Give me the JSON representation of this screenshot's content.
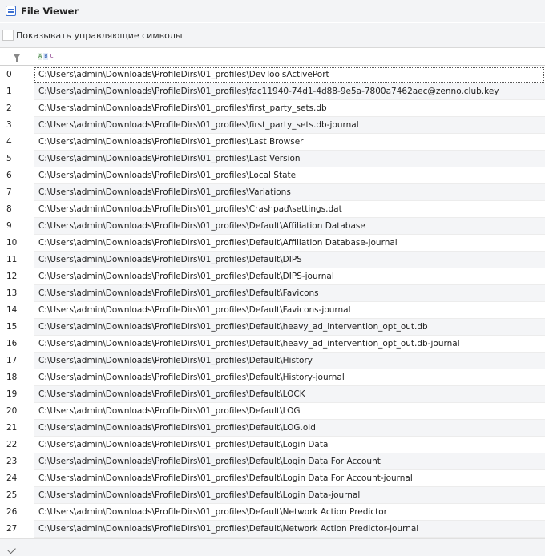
{
  "window": {
    "title": "File Viewer",
    "title_icon": "list-icon"
  },
  "options": {
    "show_control_chars_label": "Показывать управляющие символы",
    "show_control_chars_checked": false
  },
  "grid": {
    "filter_icon": "filter-icon",
    "column_type_icon": "abc-icon",
    "rows": [
      {
        "index": "0",
        "value": "C:\\Users\\admin\\Downloads\\ProfileDirs\\01_profiles\\DevToolsActivePort"
      },
      {
        "index": "1",
        "value": "C:\\Users\\admin\\Downloads\\ProfileDirs\\01_profiles\\fac11940-74d1-4d88-9e5a-7800a7462aec@zenno.club.key"
      },
      {
        "index": "2",
        "value": "C:\\Users\\admin\\Downloads\\ProfileDirs\\01_profiles\\first_party_sets.db"
      },
      {
        "index": "3",
        "value": "C:\\Users\\admin\\Downloads\\ProfileDirs\\01_profiles\\first_party_sets.db-journal"
      },
      {
        "index": "4",
        "value": "C:\\Users\\admin\\Downloads\\ProfileDirs\\01_profiles\\Last Browser"
      },
      {
        "index": "5",
        "value": "C:\\Users\\admin\\Downloads\\ProfileDirs\\01_profiles\\Last Version"
      },
      {
        "index": "6",
        "value": "C:\\Users\\admin\\Downloads\\ProfileDirs\\01_profiles\\Local State"
      },
      {
        "index": "7",
        "value": "C:\\Users\\admin\\Downloads\\ProfileDirs\\01_profiles\\Variations"
      },
      {
        "index": "8",
        "value": "C:\\Users\\admin\\Downloads\\ProfileDirs\\01_profiles\\Crashpad\\settings.dat"
      },
      {
        "index": "9",
        "value": "C:\\Users\\admin\\Downloads\\ProfileDirs\\01_profiles\\Default\\Affiliation Database"
      },
      {
        "index": "10",
        "value": "C:\\Users\\admin\\Downloads\\ProfileDirs\\01_profiles\\Default\\Affiliation Database-journal"
      },
      {
        "index": "11",
        "value": "C:\\Users\\admin\\Downloads\\ProfileDirs\\01_profiles\\Default\\DIPS"
      },
      {
        "index": "12",
        "value": "C:\\Users\\admin\\Downloads\\ProfileDirs\\01_profiles\\Default\\DIPS-journal"
      },
      {
        "index": "13",
        "value": "C:\\Users\\admin\\Downloads\\ProfileDirs\\01_profiles\\Default\\Favicons"
      },
      {
        "index": "14",
        "value": "C:\\Users\\admin\\Downloads\\ProfileDirs\\01_profiles\\Default\\Favicons-journal"
      },
      {
        "index": "15",
        "value": "C:\\Users\\admin\\Downloads\\ProfileDirs\\01_profiles\\Default\\heavy_ad_intervention_opt_out.db"
      },
      {
        "index": "16",
        "value": "C:\\Users\\admin\\Downloads\\ProfileDirs\\01_profiles\\Default\\heavy_ad_intervention_opt_out.db-journal"
      },
      {
        "index": "17",
        "value": "C:\\Users\\admin\\Downloads\\ProfileDirs\\01_profiles\\Default\\History"
      },
      {
        "index": "18",
        "value": "C:\\Users\\admin\\Downloads\\ProfileDirs\\01_profiles\\Default\\History-journal"
      },
      {
        "index": "19",
        "value": "C:\\Users\\admin\\Downloads\\ProfileDirs\\01_profiles\\Default\\LOCK"
      },
      {
        "index": "20",
        "value": "C:\\Users\\admin\\Downloads\\ProfileDirs\\01_profiles\\Default\\LOG"
      },
      {
        "index": "21",
        "value": "C:\\Users\\admin\\Downloads\\ProfileDirs\\01_profiles\\Default\\LOG.old"
      },
      {
        "index": "22",
        "value": "C:\\Users\\admin\\Downloads\\ProfileDirs\\01_profiles\\Default\\Login Data"
      },
      {
        "index": "23",
        "value": "C:\\Users\\admin\\Downloads\\ProfileDirs\\01_profiles\\Default\\Login Data For Account"
      },
      {
        "index": "24",
        "value": "C:\\Users\\admin\\Downloads\\ProfileDirs\\01_profiles\\Default\\Login Data For Account-journal"
      },
      {
        "index": "25",
        "value": "C:\\Users\\admin\\Downloads\\ProfileDirs\\01_profiles\\Default\\Login Data-journal"
      },
      {
        "index": "26",
        "value": "C:\\Users\\admin\\Downloads\\ProfileDirs\\01_profiles\\Default\\Network Action Predictor"
      },
      {
        "index": "27",
        "value": "C:\\Users\\admin\\Downloads\\ProfileDirs\\01_profiles\\Default\\Network Action Predictor-journal"
      }
    ]
  },
  "footer": {
    "icon": "check-icon"
  }
}
